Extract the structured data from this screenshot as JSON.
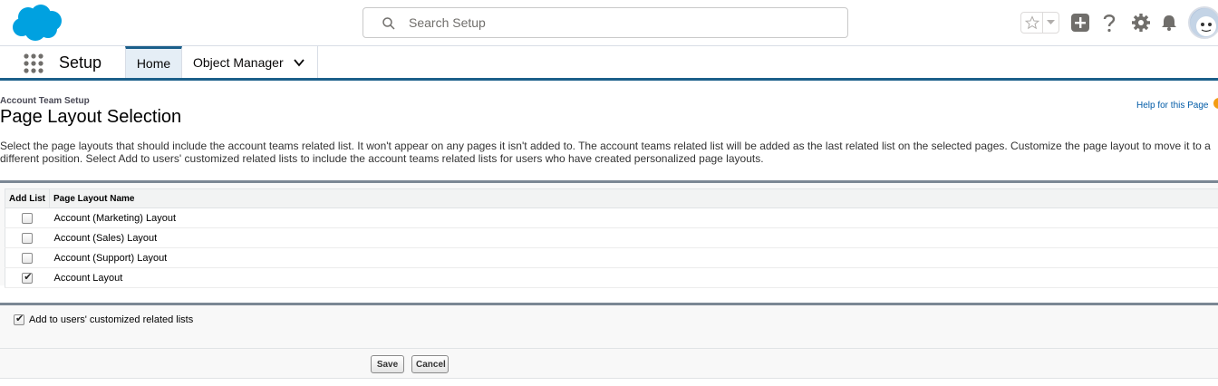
{
  "header": {
    "search_placeholder": "Search Setup",
    "icons": [
      "salesforce-cloud-logo",
      "search-icon",
      "star-icon",
      "chevron-down-icon",
      "plus-icon",
      "help-icon",
      "gear-icon",
      "bell-icon",
      "avatar"
    ],
    "brand_color": "#00a1e0"
  },
  "context_bar": {
    "app_name": "Setup",
    "tabs": [
      {
        "label": "Home",
        "active": true
      },
      {
        "label": "Object Manager",
        "active": false
      }
    ],
    "accent_color": "#1b5f8a"
  },
  "page": {
    "breadcrumb": "Account Team Setup",
    "title": "Page Layout Selection",
    "help_link": "Help for this Page",
    "description": "Select the page layouts that should include the account teams related list. It won't appear on any pages it isn't added to. The account teams related list will be added as the last related list on the selected pages. Customize the page layout to move it to a different position. Select Add to users' customized related lists to include the account teams related lists for users who have created personalized page layouts.",
    "table": {
      "headers": [
        "Add List",
        "Page Layout Name"
      ],
      "rows": [
        {
          "checked": false,
          "name": "Account (Marketing) Layout"
        },
        {
          "checked": false,
          "name": "Account (Sales) Layout"
        },
        {
          "checked": false,
          "name": "Account (Support) Layout"
        },
        {
          "checked": true,
          "name": "Account Layout"
        }
      ]
    },
    "option": {
      "checked": true,
      "label": "Add to users' customized related lists"
    },
    "buttons": {
      "save": "Save",
      "cancel": "Cancel"
    }
  }
}
